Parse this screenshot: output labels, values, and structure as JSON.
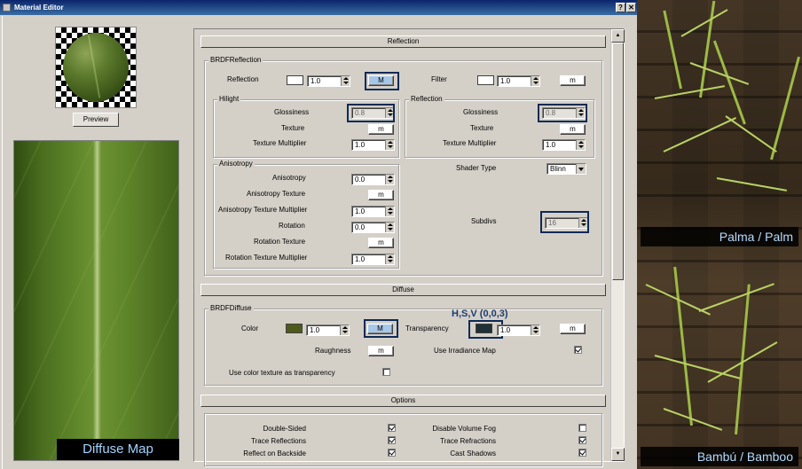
{
  "window": {
    "title": "Material Editor",
    "help_label": "?",
    "close_label": "✕"
  },
  "preview": {
    "button_label": "Preview"
  },
  "diffuse_map_label": "Diffuse Map",
  "photo_labels": {
    "palm": "Palma / Palm",
    "bamboo": "Bambú / Bamboo"
  },
  "reflection_section": {
    "title": "Reflection",
    "group_title": "BRDFReflection",
    "reflection_label": "Reflection",
    "reflection_value": "1.0",
    "reflection_map": "M",
    "filter_label": "Filter",
    "filter_value": "1.0",
    "filter_map": "m",
    "hilight": {
      "title": "Hilight",
      "glossiness_label": "Glossiness",
      "glossiness_value": "0.8",
      "texture_label": "Texture",
      "texture_map": "m",
      "multiplier_label": "Texture Multiplier",
      "multiplier_value": "1.0"
    },
    "reflection_sub": {
      "title": "Reflection",
      "glossiness_label": "Glossiness",
      "glossiness_value": "0.8",
      "texture_label": "Texture",
      "texture_map": "m",
      "multiplier_label": "Texture Multiplier",
      "multiplier_value": "1.0"
    },
    "anisotropy": {
      "title": "Anisotropy",
      "anisotropy_label": "Anisotropy",
      "anisotropy_value": "0.0",
      "aniso_texture_label": "Anisotropy Texture",
      "aniso_texture_map": "m",
      "aniso_mult_label": "Anisotropy Texture Multiplier",
      "aniso_mult_value": "1.0",
      "rotation_label": "Rotation",
      "rotation_value": "0.0",
      "rotation_texture_label": "Rotation Texture",
      "rotation_texture_map": "m",
      "rotation_mult_label": "Rotation Texture Multiplier",
      "rotation_mult_value": "1.0"
    },
    "shader_type_label": "Shader Type",
    "shader_type_value": "Blinn",
    "subdivs_label": "Subdivs",
    "subdivs_value": "16"
  },
  "diffuse_section": {
    "title": "Diffuse",
    "group_title": "BRDFDiffuse",
    "color_label": "Color",
    "color_value": "1.0",
    "color_map": "M",
    "transparency_label": "Transparency",
    "transparency_value": "1.0",
    "transparency_map": "m",
    "hsv_annotation": "H,S,V (0,0,3)",
    "roughness_label": "Raughness",
    "roughness_map": "m",
    "irradiance_label": "Use Irradiance Map",
    "color_as_transparency_label": "Use color texture as transparency"
  },
  "options_section": {
    "title": "Options",
    "double_sided": "Double-Sided",
    "trace_reflections": "Trace Reflections",
    "reflect_backside": "Reflect on Backside",
    "disable_volume_fog": "Disable Volume Fog",
    "trace_refractions": "Trace Refractions",
    "cast_shadows": "Cast Shadows"
  },
  "colors": {
    "reflection_swatch": "#ffffff",
    "filter_swatch": "#ffffff",
    "diffuse_swatch": "#4e5a1c",
    "transparency_swatch": "#1f3036",
    "highlight_box": "#0d2a55"
  }
}
